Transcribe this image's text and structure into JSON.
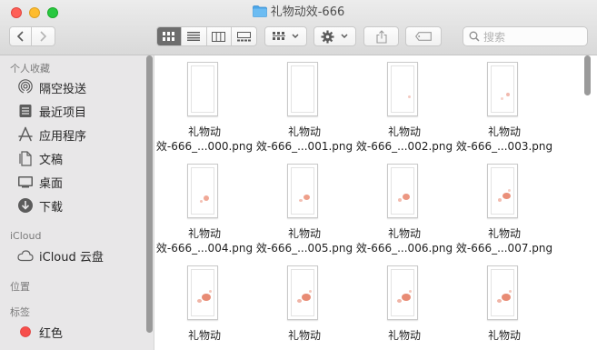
{
  "window": {
    "title": "礼物动效-666",
    "colors": {
      "close": "#fe5f57",
      "minimize": "#febc2e",
      "zoom": "#28c840",
      "folder": "#4aa5e8"
    }
  },
  "toolbar": {
    "back_icon": "chevron-left-icon",
    "forward_icon": "chevron-right-icon",
    "view_modes": [
      "icon-view",
      "list-view",
      "column-view",
      "gallery-view"
    ],
    "active_view": "icon-view",
    "search_placeholder": "搜索"
  },
  "sidebar": {
    "sections": [
      {
        "heading": "个人收藏",
        "items": [
          {
            "label": "隔空投送",
            "icon": "airdrop-icon"
          },
          {
            "label": "最近项目",
            "icon": "recents-icon"
          },
          {
            "label": "应用程序",
            "icon": "applications-icon"
          },
          {
            "label": "文稿",
            "icon": "documents-icon"
          },
          {
            "label": "桌面",
            "icon": "desktop-icon"
          },
          {
            "label": "下载",
            "icon": "downloads-icon"
          }
        ]
      },
      {
        "heading": "iCloud",
        "items": [
          {
            "label": "iCloud 云盘",
            "icon": "cloud-icon"
          }
        ]
      },
      {
        "heading": "位置",
        "items": []
      },
      {
        "heading": "标签",
        "items": [
          {
            "label": "红色",
            "icon": "red-tag-icon",
            "color": "#f64e4b"
          }
        ]
      }
    ]
  },
  "files": [
    {
      "line1": "礼物动",
      "line2": "效-666_...000.png"
    },
    {
      "line1": "礼物动",
      "line2": "效-666_...001.png"
    },
    {
      "line1": "礼物动",
      "line2": "效-666_...002.png"
    },
    {
      "line1": "礼物动",
      "line2": "效-666_...003.png"
    },
    {
      "line1": "礼物动",
      "line2": "效-666_...004.png"
    },
    {
      "line1": "礼物动",
      "line2": "效-666_...005.png"
    },
    {
      "line1": "礼物动",
      "line2": "效-666_...006.png"
    },
    {
      "line1": "礼物动",
      "line2": "效-666_...007.png"
    },
    {
      "line1": "礼物动",
      "line2": ""
    },
    {
      "line1": "礼物动",
      "line2": ""
    },
    {
      "line1": "礼物动",
      "line2": ""
    },
    {
      "line1": "礼物动",
      "line2": ""
    }
  ]
}
